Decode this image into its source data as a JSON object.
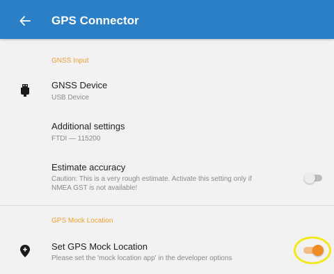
{
  "app_bar": {
    "title": "GPS Connector",
    "back_icon": "arrow-left-icon",
    "background": "#2a7fc6"
  },
  "sections": [
    {
      "header": "GNSS Input",
      "rows": [
        {
          "title": "GNSS Device",
          "subtitle": "USB Device",
          "icon": "usb-plug-icon"
        },
        {
          "title": "Additional settings",
          "subtitle": "FTDI — 115200"
        },
        {
          "title": "Estimate accuracy",
          "subtitle_lines": [
            "Caution: This is a very rough estimate. Activate this setting only if",
            "NMEA GST is not available!"
          ],
          "switch_on": false
        }
      ]
    },
    {
      "header": "GPS Mock Location",
      "rows": [
        {
          "title": "Set GPS Mock Location",
          "subtitle": "Please set the 'mock location app' in the developer options",
          "icon": "location-pin-plus-icon",
          "switch_on": true
        }
      ]
    }
  ],
  "colors": {
    "section_header": "#f0a030",
    "switch_on_thumb": "#f08c24",
    "switch_on_track": "#f3bd86",
    "highlight": "#f2e81a"
  }
}
